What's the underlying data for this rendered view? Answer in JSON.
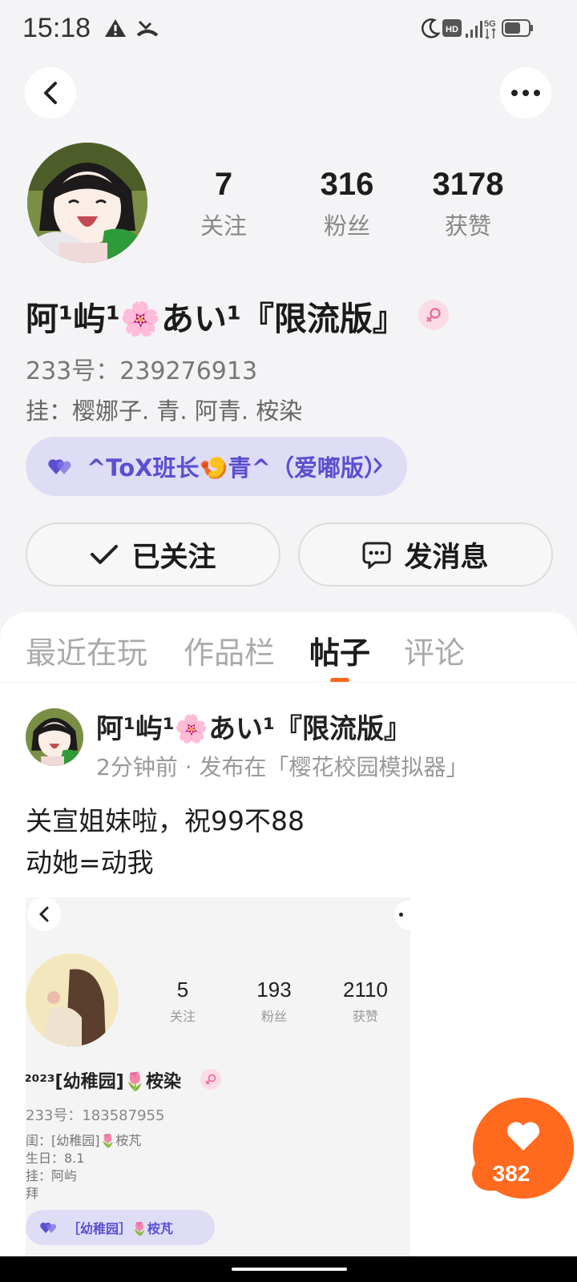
{
  "status_bar": {
    "time": "15:18",
    "icons": [
      "warning-icon",
      "missed-call-icon",
      "moon-icon",
      "hd-icon",
      "signal-icon",
      "5g-icon",
      "battery-icon"
    ]
  },
  "header": {
    "back_icon": "chevron-left-icon",
    "more_icon": "more-dots-icon"
  },
  "profile": {
    "stats": [
      {
        "value": "7",
        "label": "关注"
      },
      {
        "value": "316",
        "label": "粉丝"
      },
      {
        "value": "3178",
        "label": "获赞"
      }
    ],
    "nickname": "阿¹屿¹🌸あい¹『限流版』",
    "id_line": "233号：239276913",
    "tag_line": "挂：樱娜子. 青. 阿青. 桉染",
    "group_pill": "^ToX班长🍤青^（爱嘟版）",
    "follow_button": "已关注",
    "message_button": "发消息",
    "accent_color": "#ff6a1e",
    "pill_color": "#5a4fd1"
  },
  "tabs": [
    {
      "label": "最近在玩",
      "active": false
    },
    {
      "label": "作品栏",
      "active": false
    },
    {
      "label": "帖子",
      "active": true
    },
    {
      "label": "评论",
      "active": false
    }
  ],
  "post": {
    "author": "阿¹屿¹🌸あい¹『限流版』",
    "meta": "2分钟前 · 发布在「樱花校园模拟器」",
    "text_lines": [
      "关宣姐妹啦，祝99不88",
      "动她=动我"
    ],
    "embedded_screenshot": {
      "stats": [
        {
          "value": "5",
          "label": "关注"
        },
        {
          "value": "193",
          "label": "粉丝"
        },
        {
          "value": "2110",
          "label": "获赞"
        }
      ],
      "name": "²⁰²³[幼稚园]🌷桉染",
      "id_line": "233号：183587955",
      "lines": [
        "闺：[幼稚园]🌷桉芃",
        "生日：8.1",
        "挂：阿屿",
        "拜"
      ],
      "pill": "［幼稚园］🌷桉芃"
    }
  },
  "like": {
    "count": "382"
  }
}
